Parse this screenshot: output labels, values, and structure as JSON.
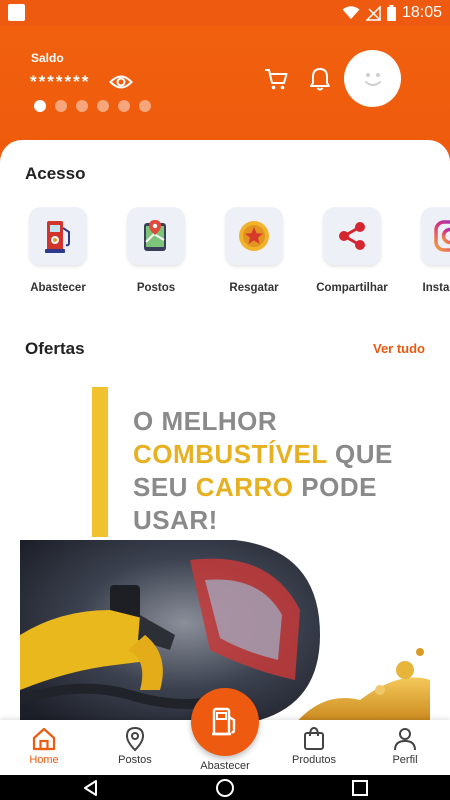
{
  "status_bar": {
    "time": "18:05",
    "icons": [
      "app-square-icon",
      "wifi-icon",
      "no-signal-icon",
      "battery-icon"
    ]
  },
  "header": {
    "balance_label": "Saldo",
    "balance_value": "*******",
    "carousel_page_count": 6,
    "carousel_active_index": 0,
    "icons": [
      "eye-icon",
      "cart-icon",
      "bell-icon",
      "avatar-smiley-icon"
    ]
  },
  "access": {
    "title": "Acesso",
    "items": [
      {
        "label": "Abastecer",
        "icon": "fuel-pump-icon"
      },
      {
        "label": "Postos",
        "icon": "map-pin-icon"
      },
      {
        "label": "Resgatar",
        "icon": "coin-star-icon"
      },
      {
        "label": "Compartilhar",
        "icon": "share-icon"
      },
      {
        "label": "Instagram",
        "icon": "instagram-icon"
      }
    ]
  },
  "offers": {
    "title": "Ofertas",
    "see_all": "Ver tudo",
    "banner": {
      "line1": "O MELHOR",
      "line2_highlight": "COMBUSTÍVEL",
      "line2_rest": " QUE",
      "line3_start": "SEU ",
      "line3_highlight": "CARRO",
      "line3_rest": " PODE",
      "line4": "USAR!"
    }
  },
  "bottom_nav": {
    "items": [
      {
        "label": "Home",
        "icon": "home-icon",
        "active": true
      },
      {
        "label": "Postos",
        "icon": "map-pin-icon"
      },
      {
        "label": "Abastecer",
        "icon": "fuel-pump-icon"
      },
      {
        "label": "Produtos",
        "icon": "shopping-bag-icon"
      },
      {
        "label": "Perfil",
        "icon": "user-icon"
      }
    ]
  },
  "colors": {
    "brand_orange": "#ee5a10",
    "banner_yellow": "#f0c230",
    "tile_bg": "#eef0f8"
  }
}
